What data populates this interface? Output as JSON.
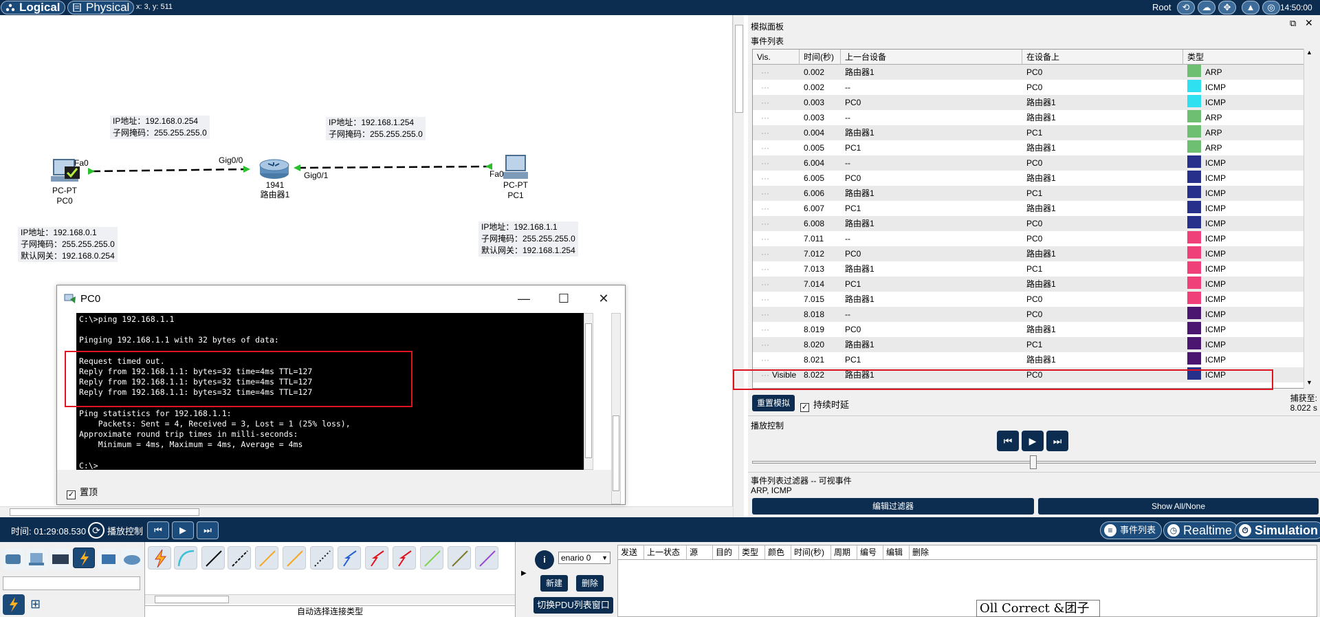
{
  "topbar": {
    "logical": "Logical",
    "physical": "Physical",
    "coords": "x: 3, y: 511",
    "root": "Root",
    "clock": "14:50:00"
  },
  "network": {
    "pc0": {
      "port": "Fa0",
      "type": "PC-PT",
      "name": "PC0",
      "ip": "IP地址：192.168.0.1",
      "mask": "子网掩码：255.255.255.0",
      "gw": "默认网关：192.168.0.254"
    },
    "pc1": {
      "port": "Fa0",
      "type": "PC-PT",
      "name": "PC1",
      "ip": "IP地址：192.168.1.1",
      "mask": "子网掩码：255.255.255.0",
      "gw": "默认网关：192.168.1.254"
    },
    "router": {
      "model": "1941",
      "name": "路由器1",
      "port_left": "Gig0/0",
      "port_right": "Gig0/1",
      "left_ip": "IP地址：192.168.0.254",
      "left_mask": "子网掩码：255.255.255.0",
      "right_ip": "IP地址：192.168.1.254",
      "right_mask": "子网掩码：255.255.255.0"
    }
  },
  "pcwindow": {
    "title": "PC0",
    "terminal": "C:\\>ping 192.168.1.1\n\nPinging 192.168.1.1 with 32 bytes of data:\n\nRequest timed out.\nReply from 192.168.1.1: bytes=32 time=4ms TTL=127\nReply from 192.168.1.1: bytes=32 time=4ms TTL=127\nReply from 192.168.1.1: bytes=32 time=4ms TTL=127\n\nPing statistics for 192.168.1.1:\n    Packets: Sent = 4, Received = 3, Lost = 1 (25% loss),\nApproximate round trip times in milli-seconds:\n    Minimum = 4ms, Maximum = 4ms, Average = 4ms\n\nC:\\>",
    "ontop_label": "置顶"
  },
  "sim": {
    "title": "模拟面板",
    "event_list_title": "事件列表",
    "headers": [
      "Vis.",
      "时间(秒)",
      "上一台设备",
      "在设备上",
      "类型"
    ],
    "rows": [
      {
        "vis": "",
        "time": "0.002",
        "prev": "路由器1",
        "at": "PC0",
        "type": "ARP",
        "color": "#6fbf73"
      },
      {
        "vis": "",
        "time": "0.002",
        "prev": "--",
        "at": "PC0",
        "type": "ICMP",
        "color": "#2ee0f0"
      },
      {
        "vis": "",
        "time": "0.003",
        "prev": "PC0",
        "at": "路由器1",
        "type": "ICMP",
        "color": "#2ee0f0"
      },
      {
        "vis": "",
        "time": "0.003",
        "prev": "--",
        "at": "路由器1",
        "type": "ARP",
        "color": "#6fbf73"
      },
      {
        "vis": "",
        "time": "0.004",
        "prev": "路由器1",
        "at": "PC1",
        "type": "ARP",
        "color": "#6fbf73"
      },
      {
        "vis": "",
        "time": "0.005",
        "prev": "PC1",
        "at": "路由器1",
        "type": "ARP",
        "color": "#6fbf73"
      },
      {
        "vis": "",
        "time": "6.004",
        "prev": "--",
        "at": "PC0",
        "type": "ICMP",
        "color": "#27318c"
      },
      {
        "vis": "",
        "time": "6.005",
        "prev": "PC0",
        "at": "路由器1",
        "type": "ICMP",
        "color": "#27318c"
      },
      {
        "vis": "",
        "time": "6.006",
        "prev": "路由器1",
        "at": "PC1",
        "type": "ICMP",
        "color": "#27318c"
      },
      {
        "vis": "",
        "time": "6.007",
        "prev": "PC1",
        "at": "路由器1",
        "type": "ICMP",
        "color": "#27318c"
      },
      {
        "vis": "",
        "time": "6.008",
        "prev": "路由器1",
        "at": "PC0",
        "type": "ICMP",
        "color": "#27318c"
      },
      {
        "vis": "",
        "time": "7.011",
        "prev": "--",
        "at": "PC0",
        "type": "ICMP",
        "color": "#f0407a"
      },
      {
        "vis": "",
        "time": "7.012",
        "prev": "PC0",
        "at": "路由器1",
        "type": "ICMP",
        "color": "#f0407a"
      },
      {
        "vis": "",
        "time": "7.013",
        "prev": "路由器1",
        "at": "PC1",
        "type": "ICMP",
        "color": "#f0407a"
      },
      {
        "vis": "",
        "time": "7.014",
        "prev": "PC1",
        "at": "路由器1",
        "type": "ICMP",
        "color": "#f0407a"
      },
      {
        "vis": "",
        "time": "7.015",
        "prev": "路由器1",
        "at": "PC0",
        "type": "ICMP",
        "color": "#f0407a"
      },
      {
        "vis": "",
        "time": "8.018",
        "prev": "--",
        "at": "PC0",
        "type": "ICMP",
        "color": "#4a1670"
      },
      {
        "vis": "",
        "time": "8.019",
        "prev": "PC0",
        "at": "路由器1",
        "type": "ICMP",
        "color": "#4a1670"
      },
      {
        "vis": "",
        "time": "8.020",
        "prev": "路由器1",
        "at": "PC1",
        "type": "ICMP",
        "color": "#4a1670"
      },
      {
        "vis": "",
        "time": "8.021",
        "prev": "PC1",
        "at": "路由器1",
        "type": "ICMP",
        "color": "#4a1670"
      },
      {
        "vis": "Visible",
        "time": "8.022",
        "prev": "路由器1",
        "at": "PC0",
        "type": "ICMP",
        "color": "#27318c"
      }
    ],
    "reset_btn": "重置模拟",
    "hold_delay": "持续时延",
    "captured_label": "捕获至:",
    "captured_value": "8.022 s",
    "playback_title": "播放控制",
    "filter_title": "事件列表过滤器 -- 可视事件",
    "filter_value": "ARP, ICMP",
    "edit_filter": "编辑过滤器",
    "show_all": "Show All/None"
  },
  "bottombar": {
    "time": "时间: 01:29:08.530",
    "playback": "播放控制",
    "event_list": "事件列表",
    "realtime": "Realtime",
    "simulation": "Simulation"
  },
  "bottom": {
    "auto_conn": "自动选择连接类型",
    "scenario": "enario 0",
    "new_btn": "新建",
    "delete_btn": "删除",
    "toggle_pdu": "切换PDU列表窗口",
    "pdu_headers": [
      "发送",
      "上一状态",
      "源",
      "目的",
      "类型",
      "颜色",
      "时间(秒)",
      "周期",
      "编号",
      "编辑",
      "删除"
    ],
    "watermark": "Oll Correct &团子"
  }
}
